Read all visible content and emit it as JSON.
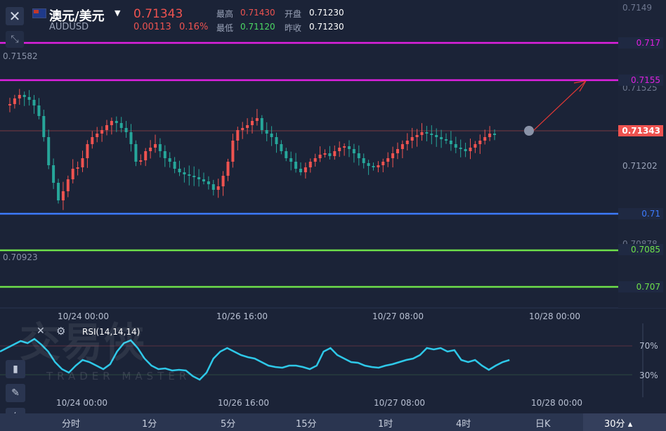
{
  "header": {
    "close_icon": "close-icon",
    "symbol_name": "澳元/美元",
    "symbol_code": "AUDUSD",
    "price": "0.71343",
    "change": "0.00113",
    "change_pct": "0.16%",
    "high_label": "最高",
    "high_value": "0.71430",
    "low_label": "最低",
    "low_value": "0.71120",
    "open_label": "开盘",
    "open_value": "0.71230",
    "prev_close_label": "昨收",
    "prev_close_value": "0.71230"
  },
  "price_axis": {
    "top_tick": "0.7149",
    "label_71582": "0.71582",
    "label_71525": "0.71525",
    "label_71202": "0.71202",
    "label_70923": "0.70923",
    "label_70878": "0.70878",
    "current_price_tag": "0.71343"
  },
  "horizontal_lines": [
    {
      "name": "line-0717",
      "label": "0.717",
      "color": "#e020e0"
    },
    {
      "name": "line-07155",
      "label": "0.7155",
      "color": "#e020e0"
    },
    {
      "name": "line-071",
      "label": "0.71",
      "color": "#3d7bff"
    },
    {
      "name": "line-07085",
      "label": "0.7085",
      "color": "#6ee04a"
    },
    {
      "name": "line-0707",
      "label": "0.707",
      "color": "#6ee04a"
    }
  ],
  "time_axis_main": [
    "10/24 00:00",
    "10/26 16:00",
    "10/27 08:00",
    "10/28 00:00"
  ],
  "indicator": {
    "name": "RSI(14,14,14)",
    "level_70": "70%",
    "level_30": "30%"
  },
  "time_axis_rsi": [
    "10/24 00:00",
    "10/26 16:00",
    "10/27 08:00",
    "10/28 00:00"
  ],
  "timeframes": [
    "分时",
    "1分",
    "5分",
    "15分",
    "1时",
    "4时",
    "日K"
  ],
  "active_timeframe": "30分",
  "watermark": {
    "cn": "交易侠",
    "en": "TRADER MASTER"
  },
  "colors": {
    "up": "#ef5350",
    "down": "#26a69a",
    "bg": "#1b2337",
    "rsi": "#2ec8e8"
  }
}
